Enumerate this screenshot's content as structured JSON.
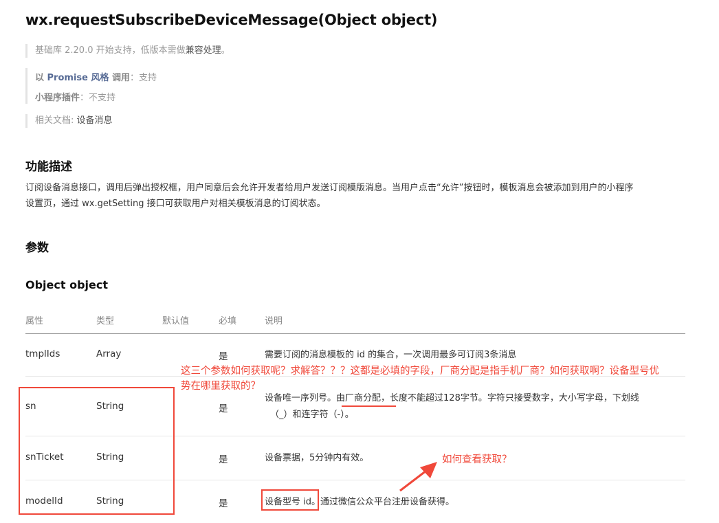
{
  "title": "wx.requestSubscribeDeviceMessage(Object object)",
  "notes": {
    "lib_prefix": "基础库 2.20.0 开始支持，低版本需做",
    "lib_link": "兼容处理",
    "lib_suffix": "。",
    "promise_prefix": "以 ",
    "promise_link": "Promise 风格",
    "promise_label": " 调用",
    "promise_value": "：支持",
    "plugin_label": "小程序插件",
    "plugin_value": "：不支持",
    "related_label": "相关文档: ",
    "related_link": "设备消息"
  },
  "section_func": "功能描述",
  "func_desc_1": "订阅设备消息接口，调用后弹出授权框，用户同意后会允许开发者给用户发送订阅模版消息。当用户点击“允许”按钮时，模板消息会被添加到用户的小程序",
  "func_desc_2": "设置页，通过 wx.getSetting 接口可获取用户对相关模板消息的订阅状态。",
  "section_params": "参数",
  "section_object": "Object object",
  "table": {
    "headers": [
      "属性",
      "类型",
      "默认值",
      "必填",
      "说明"
    ],
    "rows": [
      {
        "name": "tmplIds",
        "type": "Array",
        "required": "是",
        "desc": "需要订阅的消息模板的 id 的集合，一次调用最多可订阅3条消息"
      },
      {
        "name": "sn",
        "type": "String",
        "required": "是",
        "desc_a": "设备唯一序列号。",
        "desc_b": "由厂商分配",
        "desc_c": "，长度不能超过128字节。字符只接受数字，大小写字母，下划线",
        "desc_d": "（_）和连字符（-）。"
      },
      {
        "name": "snTicket",
        "type": "String",
        "required": "是",
        "desc": "设备票据，5分钟内有效。"
      },
      {
        "name": "modelId",
        "type": "String",
        "required": "是",
        "desc_a": "设备型号 id",
        "desc_b": "。通过微信公众平台注册设备获得。"
      }
    ]
  },
  "annotations": {
    "question_1": "这三个参数如何获取呢？求解答？？？这都是必填的字段，厂商分配是指手机厂商？如何获取啊？设备型号优",
    "question_2": "势在哪里获取的？",
    "question_3": "如何查看获取？"
  },
  "colors": {
    "annotation": "#f0483a",
    "link": "#576b95"
  }
}
